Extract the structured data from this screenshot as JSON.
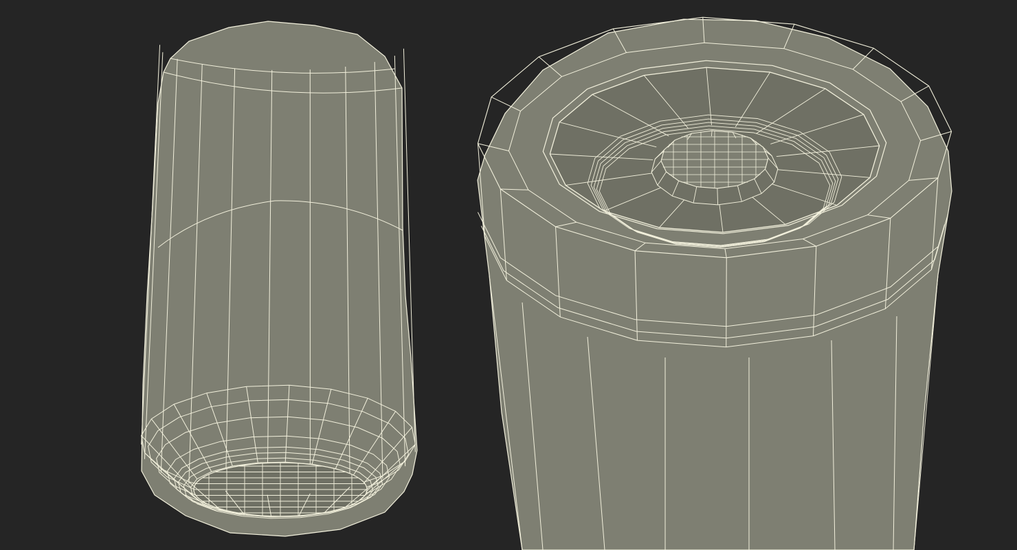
{
  "scene": {
    "background_color": "#252525",
    "surface_color": "#7e7f72",
    "surface_dark_color": "#6f7064",
    "wire_color": "#f2f0dc"
  },
  "views": [
    {
      "name": "full-view",
      "subject": "battery-cylinder-wireframe",
      "orientation": "bottom-up"
    },
    {
      "name": "closeup-view",
      "subject": "battery-positive-terminal-wireframe",
      "orientation": "top-down"
    }
  ]
}
